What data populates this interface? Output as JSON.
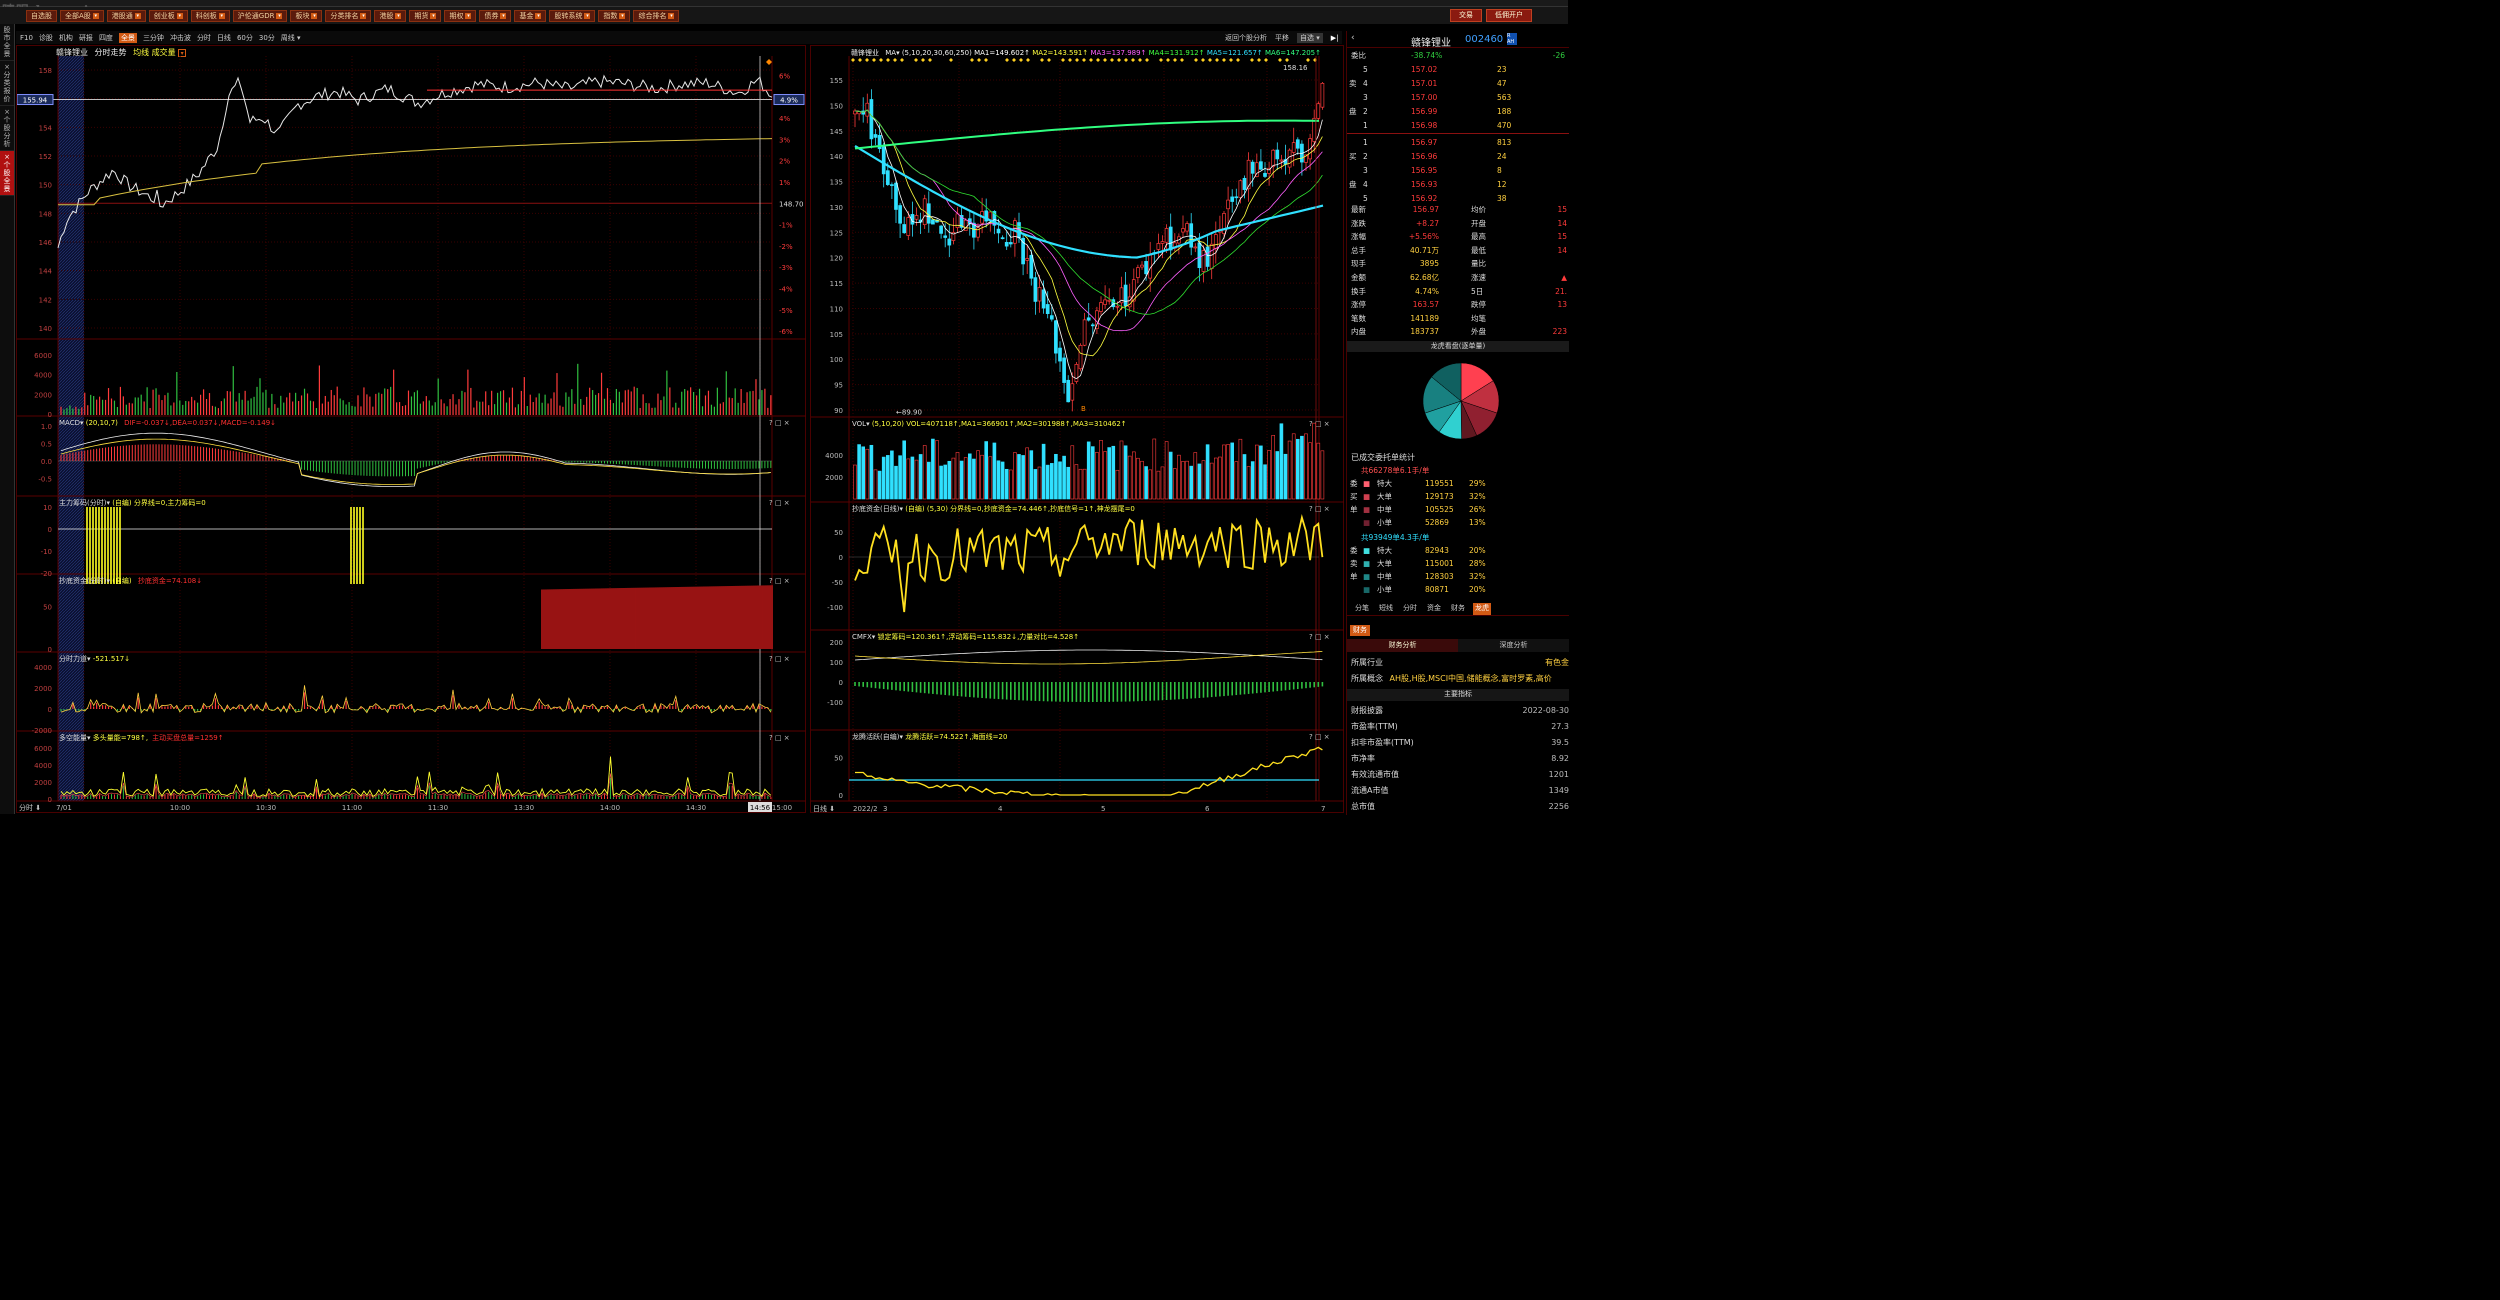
{
  "app": {
    "logo_text": "睛眼 lwangi",
    "trade_buttons": [
      "交易",
      "低佣开户"
    ]
  },
  "toolbar": {
    "items": [
      "自选股",
      "全部A股",
      "港股通",
      "创业板",
      "科创板",
      "沪伦通GDR",
      "板块",
      "分类排名",
      "港股",
      "期货",
      "期权",
      "债券",
      "基金",
      "股转系统",
      "指数",
      "综合排名"
    ]
  },
  "sidebar": {
    "tabs": [
      "股市全景",
      "分类报价",
      "个股分析",
      "个股全景"
    ]
  },
  "subbar": {
    "items": [
      "F10",
      "诊股",
      "机构",
      "研报",
      "四度",
      "全景",
      "三分钟",
      "冲击波",
      "分时",
      "日线",
      "60分",
      "30分",
      "周线"
    ],
    "active": "全景",
    "right_items": [
      "返回个股分析",
      "平移",
      "自选"
    ]
  },
  "intraday": {
    "name": "赣锋锂业",
    "label1": "分时走势",
    "label2": "均线 成交量",
    "y_left": [
      "158",
      "156",
      "154",
      "152",
      "150",
      "148",
      "146",
      "144",
      "142",
      "140"
    ],
    "y_right": [
      "6%",
      "5%",
      "4%",
      "3%",
      "2%",
      "1%",
      "148.70",
      "-1%",
      "-2%",
      "-3%",
      "-4%",
      "-5%",
      "-6%"
    ],
    "price_tag": "155.94",
    "pct_tag": "4.9%",
    "vol_labels": [
      "6000",
      "4000",
      "2000",
      "0"
    ],
    "macd_title": "MACD",
    "macd_params": "(20,10,7)",
    "macd_values": "DIF=-0.037↓,DEA=0.037↓,MACD=-0.149↓",
    "macd_labels": [
      "1.0",
      "0.5",
      "0.0",
      "-0.5"
    ],
    "zlcm_title": "主力筹码(分时)",
    "zlcm_values": "(自编) 分界线=0,主力筹码=0",
    "zlcm_labels": [
      "10",
      "0",
      "-10",
      "-20"
    ],
    "cdzj_title": "抄底资金(分时)",
    "cdzj_values": "(自编)",
    "cdzj_val2": "抄底资金=74.108↓",
    "cdzj_labels": [
      "50",
      "0"
    ],
    "fsld_title": "分时力道",
    "fsld_values": "-521.517↓",
    "fsld_labels": [
      "4000",
      "2000",
      "0",
      "-2000"
    ],
    "dknl_title": "多空能量",
    "dknl_values": "多头量能=798↑,",
    "dknl_val2": "主动买盘总量=1259↑",
    "dknl_labels": [
      "6000",
      "4000",
      "2000",
      "0"
    ],
    "time_axis": [
      "7/01",
      "10:00",
      "10:30",
      "11:00",
      "11:30",
      "13:30",
      "14:00",
      "14:30",
      "14:56",
      "15:00"
    ],
    "bottom_mode": "分时"
  },
  "kline": {
    "name": "赣锋锂业",
    "ma_label": "MA",
    "ma_params": "(5,10,20,30,60,250)",
    "ma_values": [
      {
        "text": "MA1=149.602↑",
        "color": "#ffffff"
      },
      {
        "text": "MA2=143.591↑",
        "color": "#ffff40"
      },
      {
        "text": "MA3=137.989↑",
        "color": "#ff60ff"
      },
      {
        "text": "MA4=131.912↑",
        "color": "#40ff40"
      },
      {
        "text": "MA5=121.657↑",
        "color": "#30e0ff"
      },
      {
        "text": "MA6=147.205↑",
        "color": "#30ff80"
      }
    ],
    "y_labels": [
      "155",
      "150",
      "145",
      "140",
      "135",
      "130",
      "125",
      "120",
      "115",
      "110",
      "105",
      "100",
      "95",
      "90"
    ],
    "high_label": "158.16",
    "low_label": "89.90",
    "vol_title": "VOL",
    "vol_values": "(5,10,20) VOL=407118↑,MA1=366901↑,MA2=301988↑,MA3=310462↑",
    "vol_labels": [
      "4000",
      "2000"
    ],
    "cd_title": "抄底资金(日线)",
    "cd_values": "(自编) (5,30) 分界线=0,抄底资金=74.446↑,抄底信号=1↑,神龙摆尾=0",
    "cd_labels": [
      "50",
      "0",
      "-50",
      "-100"
    ],
    "cmfx_title": "CMFX",
    "cmfx_values": "锁定筹码=120.361↑,浮动筹码=115.832↓,力量对比=4.528↑",
    "cmfx_labels": [
      "200",
      "100",
      "0",
      "-100"
    ],
    "lthy_title": "龙腾活跃(自编)",
    "lthy_values": "龙腾活跃=74.522↑,海面线=20",
    "lthy_labels": [
      "50",
      "0"
    ],
    "date_axis": [
      "2022/2",
      "3",
      "4",
      "5",
      "6",
      "7"
    ],
    "bottom_mode": "日线"
  },
  "quote": {
    "name": "赣锋锂业",
    "code": "002460",
    "webi_label": "委比",
    "webi_value": "-38.74%",
    "webi_diff": "-26",
    "sell": [
      {
        "label": "5",
        "price": "157.02",
        "vol": "23"
      },
      {
        "label": "4",
        "price": "157.01",
        "vol": "47"
      },
      {
        "label": "3",
        "price": "157.00",
        "vol": "563"
      },
      {
        "label": "2",
        "price": "156.99",
        "vol": "188"
      },
      {
        "label": "1",
        "price": "156.98",
        "vol": "470"
      }
    ],
    "buy": [
      {
        "label": "1",
        "price": "156.97",
        "vol": "813"
      },
      {
        "label": "2",
        "price": "156.96",
        "vol": "24"
      },
      {
        "label": "3",
        "price": "156.95",
        "vol": "8"
      },
      {
        "label": "4",
        "price": "156.93",
        "vol": "12"
      },
      {
        "label": "5",
        "price": "156.92",
        "vol": "38"
      }
    ],
    "side_sell": "卖",
    "side_buy": "买",
    "side_pan": "盘",
    "stats": [
      {
        "k": "最新",
        "v": "156.97",
        "k2": "均价",
        "v2": "15"
      },
      {
        "k": "涨跌",
        "v": "+8.27",
        "k2": "开盘",
        "v2": "14"
      },
      {
        "k": "涨幅",
        "v": "+5.56%",
        "k2": "最高",
        "v2": "15"
      },
      {
        "k": "总手",
        "v": "40.71万",
        "k2": "最低",
        "v2": "14"
      },
      {
        "k": "现手",
        "v": "3895",
        "k2": "量比",
        "v2": ""
      },
      {
        "k": "金额",
        "v": "62.68亿",
        "k2": "涨速",
        "v2": "▲"
      },
      {
        "k": "换手",
        "v": "4.74%",
        "k2": "5日",
        "v2": "21."
      },
      {
        "k": "涨停",
        "v": "163.57",
        "k2": "跌停",
        "v2": "13"
      },
      {
        "k": "笔数",
        "v": "141189",
        "k2": "均笔",
        "v2": ""
      },
      {
        "k": "内盘",
        "v": "183737",
        "k2": "外盘",
        "v2": "223"
      }
    ],
    "lhkp_title": "龙虎看盘(逐单量)",
    "pie_values": [
      32,
      28,
      26,
      13,
      20,
      20,
      32,
      28
    ],
    "pie_colors": [
      "#ff4050",
      "#c03040",
      "#902030",
      "#601820",
      "#30d0d0",
      "#20a0a0",
      "#188080",
      "#106060"
    ],
    "weituo_title": "已成交委托单统计",
    "buy_total": "共66278单6.1手/单",
    "sell_total": "共93949单4.3手/单",
    "side_wei": "委",
    "side_mai_buy": "买",
    "side_mai_sell": "卖",
    "side_dan": "单",
    "buy_rows": [
      {
        "label": "特大",
        "v": "119551",
        "p": "29%",
        "color": "#ff6070"
      },
      {
        "label": "大单",
        "v": "129173",
        "p": "32%",
        "color": "#d04050"
      },
      {
        "label": "中单",
        "v": "105525",
        "p": "26%",
        "color": "#a03040"
      },
      {
        "label": "小单",
        "v": "52869",
        "p": "13%",
        "color": "#702030"
      }
    ],
    "sell_rows": [
      {
        "label": "特大",
        "v": "82943",
        "p": "20%",
        "color": "#40e0e0"
      },
      {
        "label": "大单",
        "v": "115001",
        "p": "28%",
        "color": "#30b0b0"
      },
      {
        "label": "中单",
        "v": "128303",
        "p": "32%",
        "color": "#208888"
      },
      {
        "label": "小单",
        "v": "80871",
        "p": "20%",
        "color": "#186868"
      }
    ],
    "tabs": [
      "分笔",
      "短线",
      "分时",
      "资金",
      "财务",
      "龙虎"
    ],
    "tabs_active": "龙虎",
    "fin_tag": "财务",
    "fin_tabs": [
      "财务分析",
      "深度分析"
    ],
    "industry_label": "所属行业",
    "industry_value": "有色金",
    "concept_label": "所属概念",
    "concept_value": "AH股,H股,MSCI中国,储能概念,富时罗素,高价",
    "main_title": "主要指标",
    "fin_rows": [
      {
        "k": "财报披露",
        "v": "2022-08-30"
      },
      {
        "k": "市盈率(TTM)",
        "v": "27.3"
      },
      {
        "k": "扣非市盈率(TTM)",
        "v": "39.5"
      },
      {
        "k": "市净率",
        "v": "8.92"
      },
      {
        "k": "有效流通市值",
        "v": "1201"
      },
      {
        "k": "流通A市值",
        "v": "1349"
      },
      {
        "k": "总市值",
        "v": "2256"
      }
    ]
  },
  "colors": {
    "up": "#ff3b3b",
    "down": "#30e0ff",
    "grid": "#5a0000",
    "accent": "#d25a14"
  }
}
